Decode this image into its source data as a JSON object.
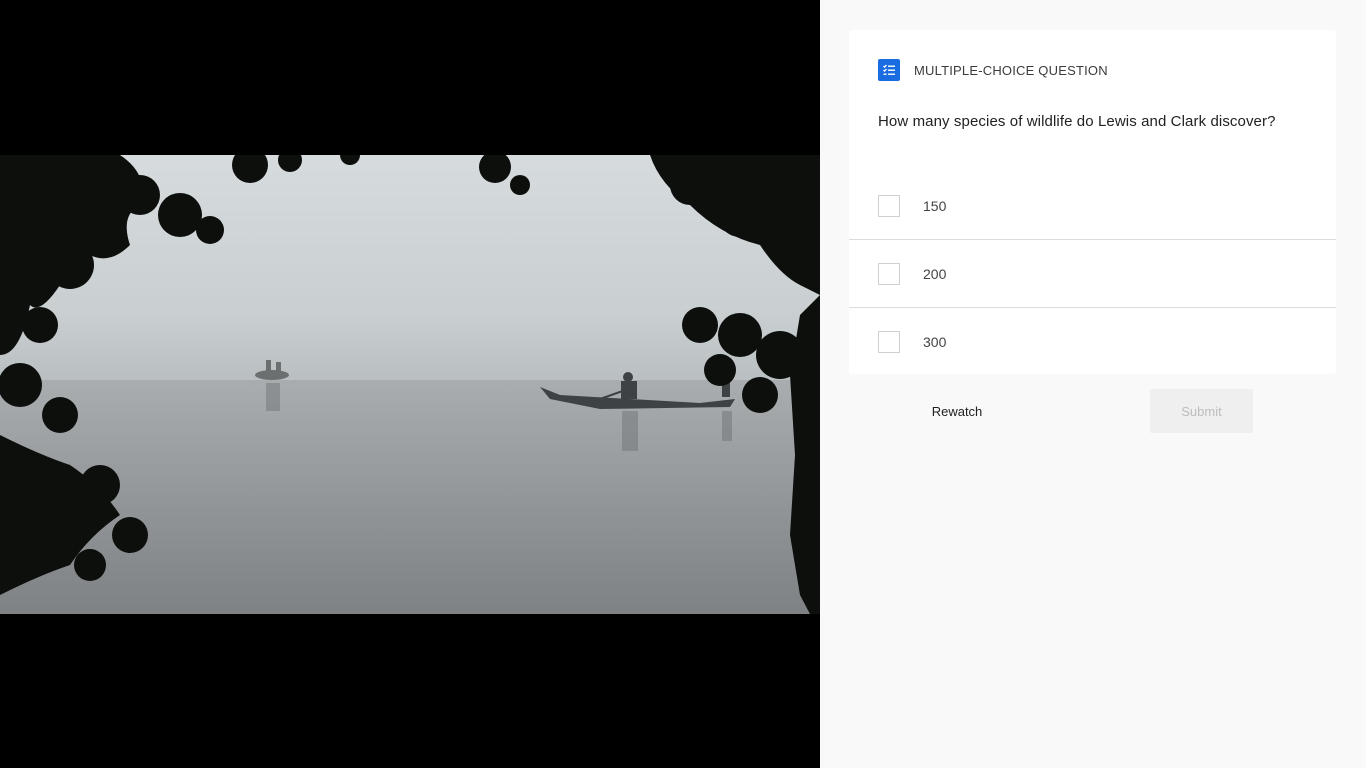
{
  "video": {
    "thumbnail_icon": "misty-river-canoes-scene"
  },
  "question": {
    "type_icon": "checklist-icon",
    "type_label": "MULTIPLE-CHOICE QUESTION",
    "text": "How many species of wildlife do Lewis and Clark discover?",
    "options": [
      {
        "label": "150",
        "checked": false
      },
      {
        "label": "200",
        "checked": false
      },
      {
        "label": "300",
        "checked": false
      }
    ]
  },
  "actions": {
    "rewatch_label": "Rewatch",
    "submit_label": "Submit",
    "submit_enabled": false
  },
  "colors": {
    "accent": "#1a6de0",
    "panel_bg": "#f9f9f9",
    "card_bg": "#ffffff",
    "disabled_bg": "#efefef",
    "disabled_text": "#bdbdbd"
  }
}
